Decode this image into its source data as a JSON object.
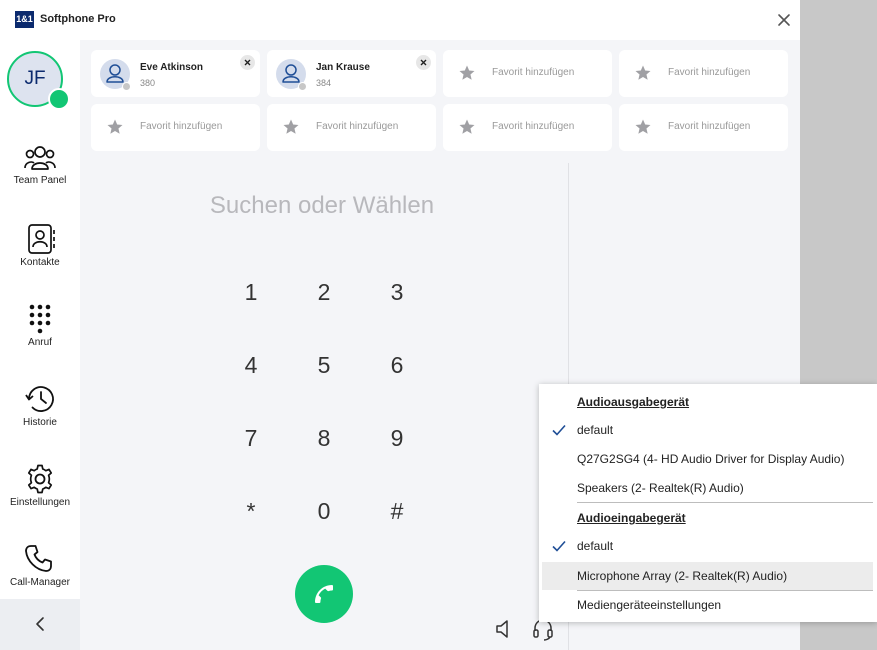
{
  "app": {
    "logo_text": "1&1",
    "title": "Softphone Pro"
  },
  "user": {
    "initials": "JF",
    "status_color": "#12c674"
  },
  "sidebar": {
    "items": [
      {
        "label": "Team Panel",
        "icon": "team-icon"
      },
      {
        "label": "Kontakte",
        "icon": "contacts-icon"
      },
      {
        "label": "Anruf",
        "icon": "dialpad-icon"
      },
      {
        "label": "Historie",
        "icon": "history-icon"
      },
      {
        "label": "Einstellungen",
        "icon": "gear-icon"
      },
      {
        "label": "Call-Manager",
        "icon": "phone-icon"
      }
    ],
    "collapse_icon": "chevron-left-icon"
  },
  "favorites": {
    "contacts": [
      {
        "name": "Eve Atkinson",
        "ext": "380"
      },
      {
        "name": "Jan Krause",
        "ext": "384"
      }
    ],
    "add_label": "Favorit hinzufügen"
  },
  "dialer": {
    "placeholder": "Suchen oder Wählen",
    "keys": [
      "1",
      "2",
      "3",
      "4",
      "5",
      "6",
      "7",
      "8",
      "9",
      "*",
      "0",
      "#"
    ]
  },
  "audio_menu": {
    "output_header": "Audioausgabegerät",
    "output_items": [
      "default",
      "Q27G2SG4 (4- HD Audio Driver for Display Audio)",
      "Speakers (2- Realtek(R) Audio)"
    ],
    "input_header": "Audioeingabegerät",
    "input_items": [
      "default",
      "Microphone Array (2- Realtek(R) Audio)"
    ],
    "settings_label": "Mediengeräteeinstellungen"
  },
  "colors": {
    "brand": "#0b2a6e",
    "accent": "#12c674",
    "check": "#1f4e96"
  }
}
